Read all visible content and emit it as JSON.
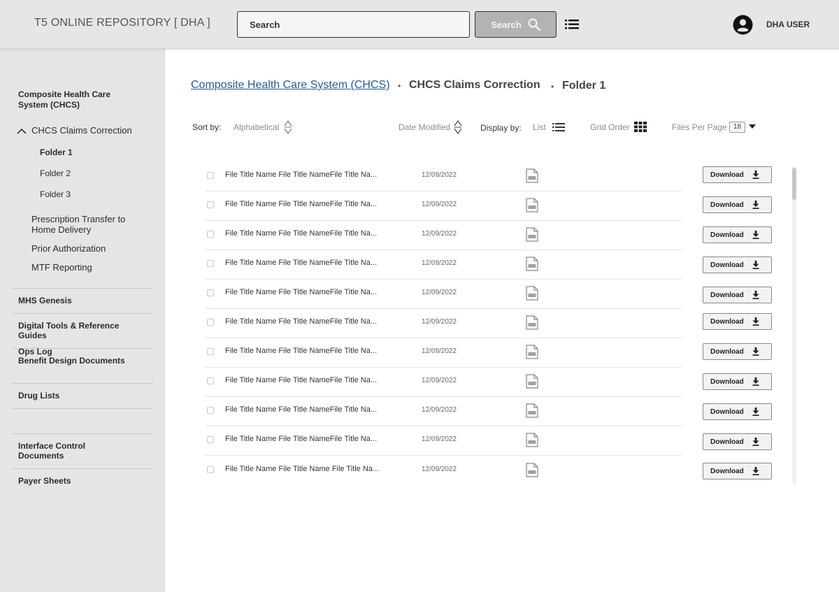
{
  "header": {
    "app_title": "T5 ONLINE REPOSITORY [ DHA ]",
    "search_placeholder": "Search",
    "search_button": "Search",
    "user_name": "DHA USER"
  },
  "sidebar": {
    "section_title": "Composite Health Care System (CHCS)",
    "expanded_item": "CHCS Claims Correction",
    "folders": [
      "Folder 1",
      "Folder 2",
      "Folder 3"
    ],
    "subitems": [
      "Prescription Transfer to Home Delivery",
      "Prior Authorization",
      "MTF Reporting"
    ],
    "sections": [
      "MHS Genesis",
      "Digital Tools & Reference Guides",
      "Ops Log",
      "Benefit Design Documents",
      "Drug Lists",
      "Interface Control Documents",
      "Payer Sheets"
    ]
  },
  "breadcrumb": {
    "root": "Composite Health Care System (CHCS)",
    "level2": "CHCS Claims Correction",
    "current": "Folder 1"
  },
  "toolbar": {
    "sort_label": "Sort by:",
    "sort_alpha": "Alphabetical",
    "sort_date": "Date Modified",
    "display_label": "Display by:",
    "display_list": "List",
    "display_grid": "Grid Order",
    "per_page_label": "Files Per Page",
    "per_page_value": "18"
  },
  "files": [
    {
      "title": "File Title Name File Title NameFile Title Na...",
      "date": "12/09/2022",
      "download": "Download"
    },
    {
      "title": "File Title Name File Title NameFile Title Na...",
      "date": "12/09/2022",
      "download": "Download"
    },
    {
      "title": "File Title Name File Title NameFile Title Na...",
      "date": "12/09/2022",
      "download": "Download"
    },
    {
      "title": "File Title Name File Title NameFile Title Na...",
      "date": "12/09/2022",
      "download": "Download"
    },
    {
      "title": "File Title Name File Title NameFile Title Na...",
      "date": "12/09/2022",
      "download": "Download"
    },
    {
      "title": "File Title Name File Title NameFile Title Na...",
      "date": "12/09/2022",
      "download": "Download"
    },
    {
      "title": "File Title Name File Title NameFile Title Na...",
      "date": "12/09/2022",
      "download": "Download"
    },
    {
      "title": "File Title Name File Title NameFile Title Na...",
      "date": "12/09/2022",
      "download": "Download"
    },
    {
      "title": "File Title Name File Title NameFile Title Na...",
      "date": "12/09/2022",
      "download": "Download"
    },
    {
      "title": "File Title Name File Title NameFile Title Na...",
      "date": "12/09/2022",
      "download": "Download"
    },
    {
      "title": "File Title Name File Title Name File Title Na...",
      "date": "12/09/2022",
      "download": "Download"
    }
  ],
  "icons": {
    "search": "search-icon",
    "menu": "list-menu-icon",
    "user": "user-avatar-icon",
    "file": "pdf-file-icon",
    "download": "download-icon"
  },
  "colors": {
    "header_bg": "#e6e6e6",
    "sidebar_bg": "#e5e5e5",
    "link": "#2a5b8c",
    "search_button_bg": "#b3b3b3"
  }
}
